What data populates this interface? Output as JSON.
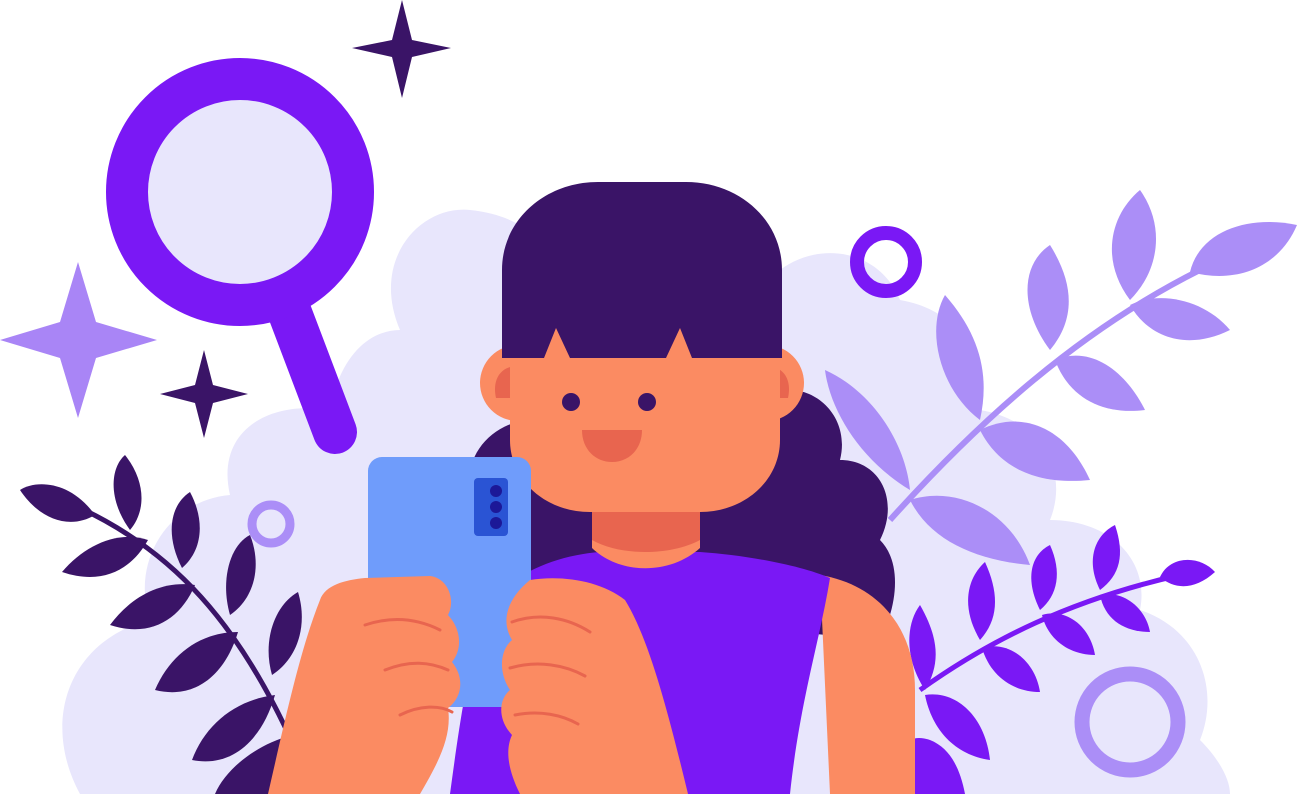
{
  "illustration": {
    "palette": {
      "background": "#ffffff",
      "cloud": "#e8e6fc",
      "hair": "#3a1467",
      "skin": "#fb8b62",
      "skin_shadow": "#e8654f",
      "shirt": "#7a18f5",
      "phone": "#6f9cfb",
      "camera_module": "#2a54d4",
      "camera_lens": "#1c1898",
      "magnifier": "#7a18f5",
      "lens_glass": "#e8e6fc",
      "sparkle_light": "#a985f6",
      "sparkle_dark": "#3a1467",
      "leaf_dark": "#3a1467",
      "leaf_light": "#ab8ef7",
      "leaf_bright": "#7a18f5",
      "ring": "#ab8ef7",
      "ring_accent": "#7a18f5"
    },
    "icons": [
      "magnifying-glass-icon",
      "sparkle-icon",
      "phone-icon",
      "leaf-branch-icon",
      "ring-icon"
    ]
  }
}
